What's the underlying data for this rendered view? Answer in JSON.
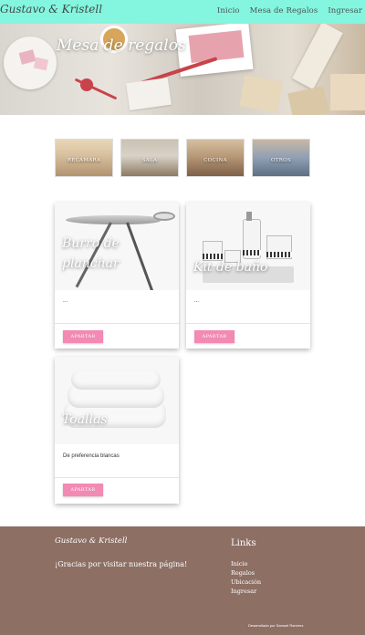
{
  "navbar": {
    "brand": "Gustavo & Kristell",
    "links": [
      "Inicio",
      "Mesa de Regalos",
      "Ingresar"
    ]
  },
  "hero": {
    "title": "Mesa de regalos"
  },
  "categories": [
    {
      "label": "RECÁMARA"
    },
    {
      "label": "SALA"
    },
    {
      "label": "COCINA"
    },
    {
      "label": "OTROS"
    }
  ],
  "products": [
    {
      "title_line1": "Burro de",
      "title_line2": "planchar",
      "description": "...",
      "button": "APARTAR"
    },
    {
      "title_line1": "Kit de baño",
      "title_line2": "",
      "description": "...",
      "button": "APARTAR"
    },
    {
      "title_line1": "Toallas",
      "title_line2": "",
      "description": "De preferencia blancas",
      "button": "APARTAR"
    }
  ],
  "footer": {
    "brand": "Gustavo & Kristell",
    "thanks": "¡Gracias por visitar nuestra página!",
    "links_title": "Links",
    "links": [
      "Inicio",
      "Regalos",
      "Ubicación",
      "Ingresar"
    ],
    "credit": "Desarrollado por Samuel Ramírez"
  },
  "colors": {
    "navbar": "#84f5df",
    "button": "#f28ab3",
    "footer": "#8d6f64"
  }
}
